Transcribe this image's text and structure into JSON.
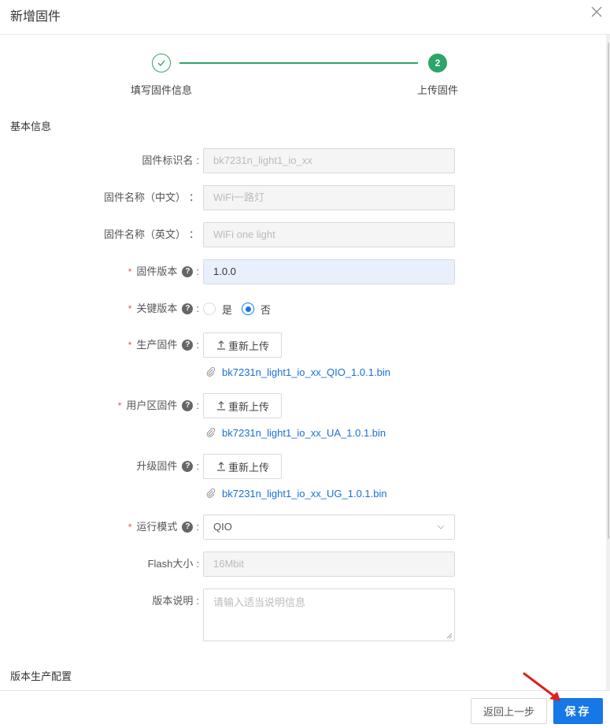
{
  "header": {
    "title": "新增固件",
    "close_icon": "close-icon"
  },
  "steps": [
    {
      "label": "填写固件信息",
      "status": "done",
      "icon": "check-icon"
    },
    {
      "label": "上传固件",
      "status": "current",
      "number": "2"
    }
  ],
  "sections": {
    "basic_info": "基本信息",
    "production_config": "版本生产配置"
  },
  "form": {
    "firmware_id": {
      "label": "固件标识名",
      "colon": ":",
      "value": "bk7231n_light1_io_xx",
      "disabled": true
    },
    "name_cn": {
      "label": "固件名称（中文）",
      "colon": "：",
      "value": "WiFi一路灯",
      "disabled": true
    },
    "name_en": {
      "label": "固件名称（英文）",
      "colon": "：",
      "value": "WiFi one light",
      "disabled": true
    },
    "version": {
      "label": "固件版本",
      "required": true,
      "help": true,
      "colon": ":",
      "value": "1.0.0"
    },
    "key_version": {
      "label": "关键版本",
      "required": true,
      "help": true,
      "colon": ":",
      "options": [
        {
          "label": "是",
          "checked": false
        },
        {
          "label": "否",
          "checked": true
        }
      ]
    },
    "production_fw": {
      "label": "生产固件",
      "required": true,
      "help": true,
      "colon": ":",
      "button": "重新上传",
      "file": "bk7231n_light1_io_xx_QIO_1.0.1.bin"
    },
    "user_fw": {
      "label": "用户区固件",
      "required": true,
      "help": true,
      "colon": ":",
      "button": "重新上传",
      "file": "bk7231n_light1_io_xx_UA_1.0.1.bin"
    },
    "upgrade_fw": {
      "label": "升级固件",
      "required": false,
      "help": true,
      "colon": ":",
      "button": "重新上传",
      "file": "bk7231n_light1_io_xx_UG_1.0.1.bin"
    },
    "run_mode": {
      "label": "运行模式",
      "required": true,
      "help": true,
      "colon": ":",
      "value": "QIO"
    },
    "flash_size": {
      "label": "Flash大小",
      "colon": ":",
      "value": "16Mbit",
      "disabled": true
    },
    "description": {
      "label": "版本说明",
      "colon": ":",
      "placeholder": "请输入适当说明信息",
      "value": ""
    }
  },
  "symbols": {
    "required_mark": "*",
    "help_mark": "?"
  },
  "footer": {
    "back_label": "返回上一步",
    "save_label": "保存"
  },
  "colors": {
    "primary": "#1677e6",
    "success": "#2ca56b",
    "required": "#e8534b",
    "link": "#1a6fd9",
    "annotation": "#e02020"
  }
}
